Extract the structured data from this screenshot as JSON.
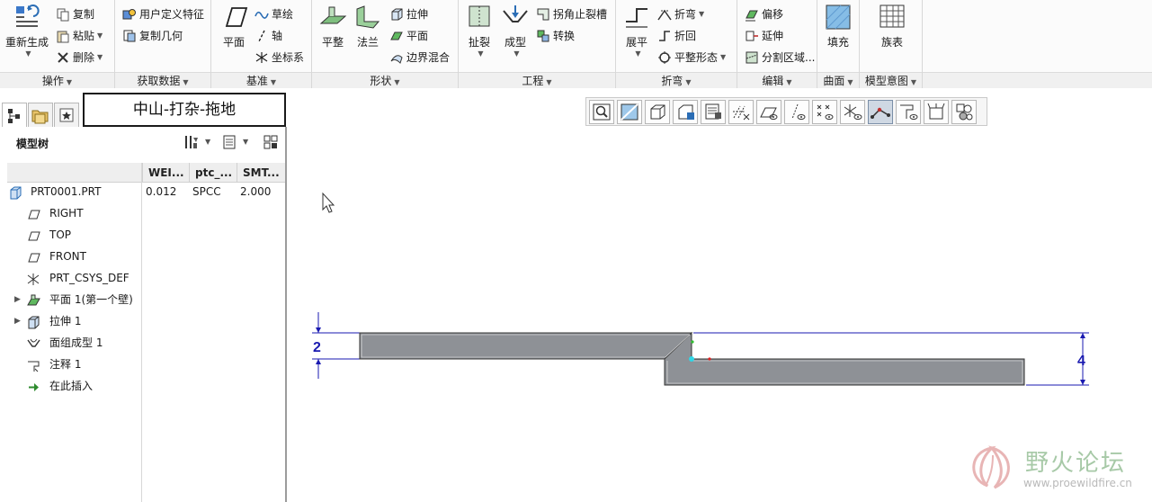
{
  "ribbon": {
    "operations": {
      "label": "操作",
      "regen": "重新生成",
      "copy": "复制",
      "paste": "粘贴",
      "delete": "删除"
    },
    "get_data": {
      "label": "获取数据",
      "udf": "用户定义特征",
      "copy_geom": "复制几何"
    },
    "datum": {
      "label": "基准",
      "plane": "平面",
      "sketch": "草绘",
      "axis": "轴",
      "csys": "坐标系"
    },
    "shapes": {
      "label": "形状",
      "flat": "平整",
      "flange": "法兰",
      "extrude": "拉伸",
      "planar": "平面",
      "blend": "边界混合"
    },
    "engineering": {
      "label": "工程",
      "rip": "扯裂",
      "form": "成型",
      "corner_relief": "拐角止裂槽",
      "convert": "转换"
    },
    "bends": {
      "label": "折弯",
      "unbend": "展平",
      "bend": "折弯",
      "bend_back": "折回",
      "flat_state": "平整形态"
    },
    "editing": {
      "label": "编辑",
      "offset": "偏移",
      "extend": "延伸",
      "split": "分割区域..."
    },
    "surfaces": {
      "label": "曲面",
      "fill": "填充"
    },
    "model_intent": {
      "label": "模型意图",
      "family_table": "族表"
    }
  },
  "title_box": "中山-打杂-拖地",
  "model_tree": {
    "title": "模型树",
    "columns": [
      "WEI...",
      "ptc_...",
      "SMT..."
    ],
    "rows": [
      {
        "label": "PRT0001.PRT",
        "icon": "part-icon",
        "c1": "0.012",
        "c2": "SPCC",
        "c3": "2.000",
        "expand": ""
      },
      {
        "label": "RIGHT",
        "icon": "datum-plane-icon",
        "expand": ""
      },
      {
        "label": "TOP",
        "icon": "datum-plane-icon",
        "expand": ""
      },
      {
        "label": "FRONT",
        "icon": "datum-plane-icon",
        "expand": ""
      },
      {
        "label": "PRT_CSYS_DEF",
        "icon": "csys-icon",
        "expand": ""
      },
      {
        "label": "平面 1(第一个壁)",
        "icon": "flat-wall-icon",
        "expand": "▶"
      },
      {
        "label": "拉伸 1",
        "icon": "extrude-icon",
        "expand": "▶"
      },
      {
        "label": "面组成型 1",
        "icon": "quilt-form-icon",
        "expand": ""
      },
      {
        "label": "注释 1",
        "icon": "annotation-icon",
        "expand": ""
      },
      {
        "label": "在此插入",
        "icon": "insert-here-icon",
        "expand": ""
      }
    ]
  },
  "drawing": {
    "dim_left": "2",
    "dim_right": "4"
  },
  "watermark": {
    "title": "野火论坛",
    "url": "www.proewildfire.cn"
  },
  "colors": {
    "part_fill": "#8e9196",
    "dim_line": "#1a1ab0",
    "accent": "#2a6db5"
  }
}
